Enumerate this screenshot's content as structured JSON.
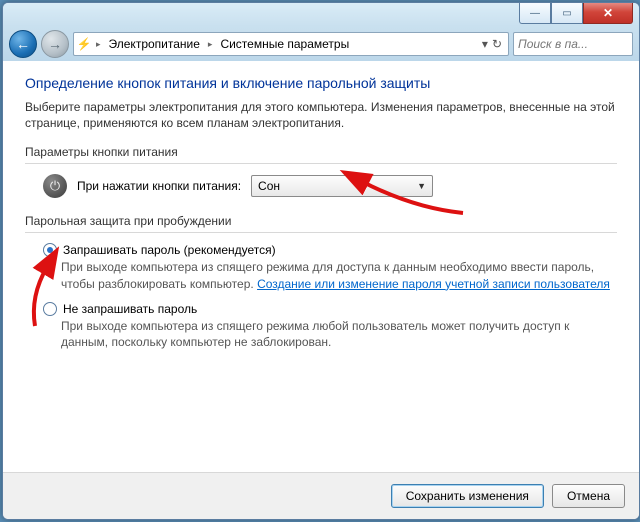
{
  "titlebar": {
    "min": "—",
    "max": "▭",
    "close": "✕"
  },
  "nav": {
    "back": "←",
    "forward": "→",
    "refresh": "↻",
    "dropdown": "▾"
  },
  "breadcrumb": {
    "icon": "⚡",
    "seg1": "Электропитание",
    "seg2": "Системные параметры"
  },
  "search": {
    "placeholder": "Поиск в па..."
  },
  "page": {
    "heading": "Определение кнопок питания и включение парольной защиты",
    "intro": "Выберите параметры электропитания для этого компьютера. Изменения параметров, внесенные на этой странице, применяются ко всем планам электропитания."
  },
  "group_power": {
    "legend": "Параметры кнопки питания",
    "label": "При нажатии кнопки питания:",
    "value": "Сон"
  },
  "group_pass": {
    "legend": "Парольная защита при пробуждении",
    "opt1": {
      "label": "Запрашивать пароль (рекомендуется)",
      "desc_a": "При выходе компьютера из спящего режима для доступа к данным необходимо ввести пароль, чтобы разблокировать компьютер. ",
      "link": "Создание или изменение пароля учетной записи пользователя"
    },
    "opt2": {
      "label": "Не запрашивать пароль",
      "desc": "При выходе компьютера из спящего режима любой пользователь может получить доступ к данным, поскольку компьютер не заблокирован."
    }
  },
  "footer": {
    "save": "Сохранить изменения",
    "cancel": "Отмена"
  }
}
